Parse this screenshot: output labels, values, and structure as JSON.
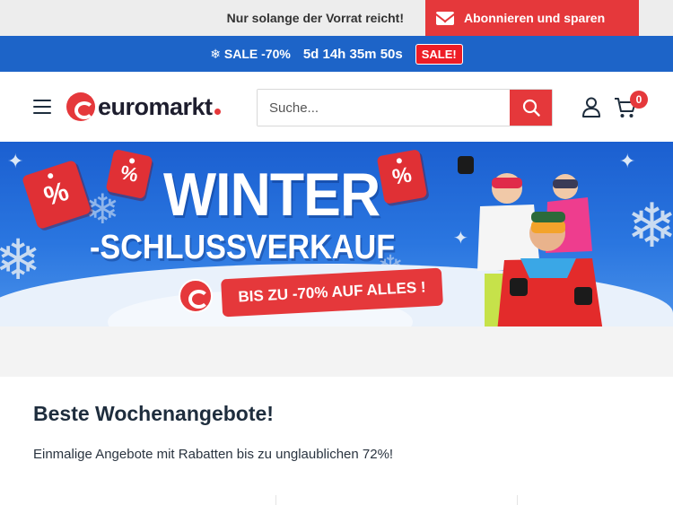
{
  "topbar": {
    "note": "Nur solange der Vorrat reicht!",
    "subscribe_label": "Abonnieren und sparen"
  },
  "salebar": {
    "sale_label": "❄ SALE -70%",
    "countdown": "5d 14h 35m 50s",
    "badge": "SALE!"
  },
  "header": {
    "logo_text": "euromarkt",
    "search_placeholder": "Suche...",
    "cart_count": "0"
  },
  "banner": {
    "title": "WINTER",
    "subtitle": "-SCHLUSSVERKAUF",
    "cta": "BIS ZU -70% AUF ALLES !",
    "tag_symbol": "%"
  },
  "section": {
    "title": "Beste Wochenangebote!",
    "description": "Einmalige Angebote mit Rabatten bis zu unglaublichen 72%!"
  },
  "colors": {
    "accent_red": "#e5383b",
    "sale_blue": "#1d64c8",
    "topbar_grey": "#ededed",
    "text_dark": "#1e2d3d"
  },
  "icons": {
    "menu": "hamburger-icon",
    "search": "search-icon",
    "account": "user-icon",
    "cart": "cart-icon",
    "mail": "mail-icon"
  }
}
